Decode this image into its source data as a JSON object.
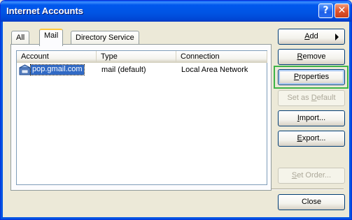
{
  "window": {
    "title": "Internet Accounts"
  },
  "titlebar": {
    "help_label": "?",
    "close_label": "✕"
  },
  "tabs": [
    {
      "label": "All"
    },
    {
      "label": "Mail"
    },
    {
      "label": "Directory Service"
    }
  ],
  "listview": {
    "columns": [
      "Account",
      "Type",
      "Connection"
    ],
    "rows": [
      {
        "account": "pop.gmail.com",
        "type": "mail (default)",
        "connection": "Local Area Network"
      }
    ]
  },
  "buttons": {
    "add": {
      "pre": "",
      "u": "A",
      "post": "dd"
    },
    "remove": {
      "pre": "",
      "u": "R",
      "post": "emove"
    },
    "properties": {
      "pre": "",
      "u": "P",
      "post": "roperties"
    },
    "set_default": {
      "pre": "Set as ",
      "u": "D",
      "post": "efault"
    },
    "import": {
      "pre": "",
      "u": "I",
      "post": "mport..."
    },
    "export": {
      "pre": "",
      "u": "E",
      "post": "xport..."
    },
    "set_order": {
      "pre": "",
      "u": "S",
      "post": "et Order..."
    },
    "close": {
      "pre": "Close",
      "u": "",
      "post": ""
    }
  },
  "colors": {
    "titlebar": "#0054e3",
    "selection": "#316ac5",
    "focus_highlight": "#3eb447"
  }
}
